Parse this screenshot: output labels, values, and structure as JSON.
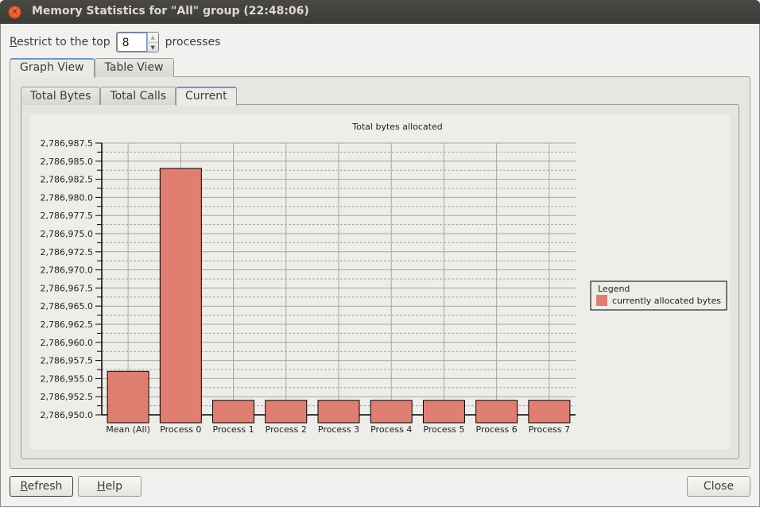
{
  "window": {
    "title": "Memory Statistics for \"All\" group (22:48:06)",
    "close_icon": "close-x"
  },
  "restrict": {
    "label_prefix_mnemonic": "R",
    "label_prefix_rest": "estrict to the top",
    "value": "8",
    "label_suffix": "processes",
    "spin_up_icon": "▲",
    "spin_down_icon": "▼"
  },
  "outer_tabs": [
    {
      "label": "Graph View",
      "active": true
    },
    {
      "label": "Table View",
      "active": false
    }
  ],
  "inner_tabs": [
    {
      "label": "Total Bytes",
      "active": false
    },
    {
      "label": "Total Calls",
      "active": false
    },
    {
      "label": "Current",
      "active": true
    }
  ],
  "buttons": {
    "refresh_mnemonic": "R",
    "refresh_rest": "efresh",
    "help_mnemonic": "H",
    "help_rest": "elp",
    "close": "Close"
  },
  "colors": {
    "bar_fill": "#e07f71",
    "bar_stroke": "#000000",
    "grid": "#a8a6a2",
    "chart_bg": "#efede9",
    "tab_accent": "#6f95c8"
  },
  "chart_data": {
    "type": "bar",
    "title": "Total bytes allocated",
    "xlabel": "",
    "ylabel": "",
    "categories": [
      "Mean (All)",
      "Process 0",
      "Process 1",
      "Process 2",
      "Process 3",
      "Process 4",
      "Process 5",
      "Process 6",
      "Process 7"
    ],
    "series": [
      {
        "name": "currently allocated bytes",
        "values": [
          2786956.0,
          2786984.0,
          2786952.0,
          2786952.0,
          2786952.0,
          2786952.0,
          2786952.0,
          2786952.0,
          2786952.0
        ]
      }
    ],
    "ylim": [
      2786950.0,
      2786987.5
    ],
    "yticks": [
      "2,786,950.0",
      "2,786,952.5",
      "2,786,955.0",
      "2,786,957.5",
      "2,786,960.0",
      "2,786,962.5",
      "2,786,965.0",
      "2,786,967.5",
      "2,786,970.0",
      "2,786,972.5",
      "2,786,975.0",
      "2,786,977.5",
      "2,786,980.0",
      "2,786,982.5",
      "2,786,985.0",
      "2,786,987.5"
    ],
    "ytick_step": 2.5,
    "grid": true,
    "legend": {
      "title": "Legend",
      "position": "right"
    }
  }
}
